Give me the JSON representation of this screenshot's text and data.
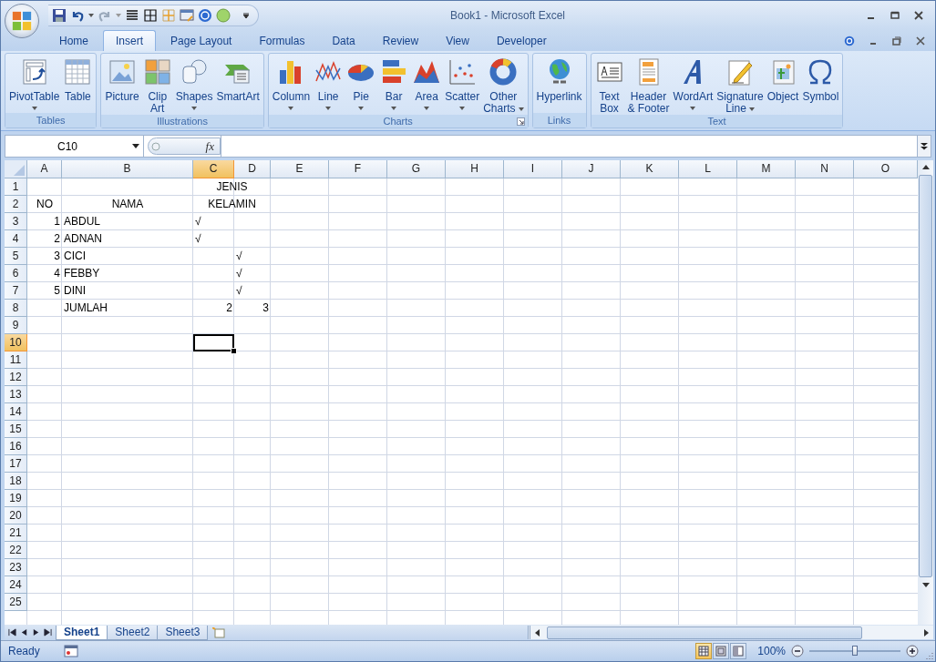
{
  "window": {
    "title": "Book1 - Microsoft Excel"
  },
  "tabs": [
    {
      "label": "Home",
      "selected": false
    },
    {
      "label": "Insert",
      "selected": true
    },
    {
      "label": "Page Layout",
      "selected": false
    },
    {
      "label": "Formulas",
      "selected": false
    },
    {
      "label": "Data",
      "selected": false
    },
    {
      "label": "Review",
      "selected": false
    },
    {
      "label": "View",
      "selected": false
    },
    {
      "label": "Developer",
      "selected": false
    }
  ],
  "ribbon": [
    {
      "label": "Tables",
      "launcher": false,
      "buttons": [
        {
          "kind": "pivot",
          "lines": [
            "PivotTable"
          ],
          "dropdown": true
        },
        {
          "kind": "table",
          "lines": [
            "Table"
          ],
          "dropdown": false
        }
      ]
    },
    {
      "label": "Illustrations",
      "launcher": false,
      "buttons": [
        {
          "kind": "picture",
          "lines": [
            "Picture"
          ],
          "dropdown": false
        },
        {
          "kind": "clipart",
          "lines": [
            "Clip",
            "Art"
          ],
          "dropdown": false
        },
        {
          "kind": "shapes",
          "lines": [
            "Shapes"
          ],
          "dropdown": true
        },
        {
          "kind": "smartart",
          "lines": [
            "SmartArt"
          ],
          "dropdown": false
        }
      ]
    },
    {
      "label": "Charts",
      "launcher": true,
      "buttons": [
        {
          "kind": "column",
          "lines": [
            "Column"
          ],
          "dropdown": true
        },
        {
          "kind": "line",
          "lines": [
            "Line"
          ],
          "dropdown": true
        },
        {
          "kind": "pie",
          "lines": [
            "Pie"
          ],
          "dropdown": true
        },
        {
          "kind": "bar",
          "lines": [
            "Bar"
          ],
          "dropdown": true
        },
        {
          "kind": "area",
          "lines": [
            "Area"
          ],
          "dropdown": true
        },
        {
          "kind": "scatter",
          "lines": [
            "Scatter"
          ],
          "dropdown": true
        },
        {
          "kind": "other",
          "lines": [
            "Other",
            "Charts"
          ],
          "dropdown": true
        }
      ]
    },
    {
      "label": "Links",
      "launcher": false,
      "buttons": [
        {
          "kind": "hyperlink",
          "lines": [
            "Hyperlink"
          ],
          "dropdown": false
        }
      ]
    },
    {
      "label": "Text",
      "launcher": false,
      "buttons": [
        {
          "kind": "textbox",
          "lines": [
            "Text",
            "Box"
          ],
          "dropdown": false
        },
        {
          "kind": "header",
          "lines": [
            "Header",
            "& Footer"
          ],
          "dropdown": false
        },
        {
          "kind": "wordart",
          "lines": [
            "WordArt"
          ],
          "dropdown": true
        },
        {
          "kind": "signature",
          "lines": [
            "Signature",
            "Line"
          ],
          "dropdown": true
        },
        {
          "kind": "object",
          "lines": [
            "Object"
          ],
          "dropdown": false
        },
        {
          "kind": "symbol",
          "lines": [
            "Symbol"
          ],
          "dropdown": false
        }
      ]
    }
  ],
  "name_box": "C10",
  "fx": "fx",
  "columns": [
    {
      "label": "A",
      "selected": false
    },
    {
      "label": "B",
      "selected": false
    },
    {
      "label": "C",
      "selected": true
    },
    {
      "label": "D",
      "selected": false
    },
    {
      "label": "E",
      "selected": false
    },
    {
      "label": "F",
      "selected": false
    },
    {
      "label": "G",
      "selected": false
    },
    {
      "label": "H",
      "selected": false
    },
    {
      "label": "I",
      "selected": false
    },
    {
      "label": "J",
      "selected": false
    },
    {
      "label": "K",
      "selected": false
    },
    {
      "label": "L",
      "selected": false
    },
    {
      "label": "M",
      "selected": false
    },
    {
      "label": "N",
      "selected": false
    },
    {
      "label": "O",
      "selected": false
    }
  ],
  "rows": [
    {
      "label": "1",
      "selected": false,
      "cells": {
        "c": {
          "text": "JENIS",
          "kind": "merged-header"
        }
      }
    },
    {
      "label": "2",
      "selected": false,
      "cells": {
        "a": {
          "text": "NO",
          "kind": "header"
        },
        "b": {
          "text": "NAMA",
          "kind": "header"
        },
        "c": {
          "text": "KELAMIN",
          "kind": "merged-header"
        }
      }
    },
    {
      "label": "3",
      "selected": false,
      "cells": {
        "a": {
          "text": "1",
          "kind": "number"
        },
        "b": {
          "text": "ABDUL",
          "kind": "text"
        },
        "c": {
          "text": "√",
          "kind": "text"
        }
      }
    },
    {
      "label": "4",
      "selected": false,
      "cells": {
        "a": {
          "text": "2",
          "kind": "number"
        },
        "b": {
          "text": "ADNAN",
          "kind": "text"
        },
        "c": {
          "text": "√",
          "kind": "text"
        }
      }
    },
    {
      "label": "5",
      "selected": false,
      "cells": {
        "a": {
          "text": "3",
          "kind": "number"
        },
        "b": {
          "text": "CICI",
          "kind": "text"
        },
        "d": {
          "text": "√",
          "kind": "text"
        }
      }
    },
    {
      "label": "6",
      "selected": false,
      "cells": {
        "a": {
          "text": "4",
          "kind": "number"
        },
        "b": {
          "text": "FEBBY",
          "kind": "text"
        },
        "d": {
          "text": "√",
          "kind": "text"
        }
      }
    },
    {
      "label": "7",
      "selected": false,
      "cells": {
        "a": {
          "text": "5",
          "kind": "number"
        },
        "b": {
          "text": "DINI",
          "kind": "text"
        },
        "d": {
          "text": "√",
          "kind": "text"
        }
      }
    },
    {
      "label": "8",
      "selected": false,
      "cells": {
        "b": {
          "text": "JUMLAH",
          "kind": "text"
        },
        "c": {
          "text": "2",
          "kind": "number"
        },
        "d": {
          "text": "3",
          "kind": "number"
        }
      }
    },
    {
      "label": "9",
      "selected": false
    },
    {
      "label": "10",
      "selected": true
    },
    {
      "label": "11",
      "selected": false
    },
    {
      "label": "12",
      "selected": false
    },
    {
      "label": "13",
      "selected": false
    },
    {
      "label": "14",
      "selected": false
    },
    {
      "label": "15",
      "selected": false
    },
    {
      "label": "16",
      "selected": false
    },
    {
      "label": "17",
      "selected": false
    },
    {
      "label": "18",
      "selected": false
    },
    {
      "label": "19",
      "selected": false
    },
    {
      "label": "20",
      "selected": false
    },
    {
      "label": "21",
      "selected": false
    },
    {
      "label": "22",
      "selected": false
    },
    {
      "label": "23",
      "selected": false
    },
    {
      "label": "24",
      "selected": false
    },
    {
      "label": "25",
      "selected": false
    }
  ],
  "sheet_tabs": [
    {
      "label": "Sheet1",
      "selected": true
    },
    {
      "label": "Sheet2",
      "selected": false
    },
    {
      "label": "Sheet3",
      "selected": false
    }
  ],
  "status_bar": {
    "text": "Ready",
    "zoom": "100%",
    "zoom_slider": {
      "level": 0.5
    },
    "views": [
      {
        "kind": "normal",
        "selected": true
      },
      {
        "kind": "page-layout",
        "selected": false
      },
      {
        "kind": "page-break",
        "selected": false
      }
    ]
  }
}
